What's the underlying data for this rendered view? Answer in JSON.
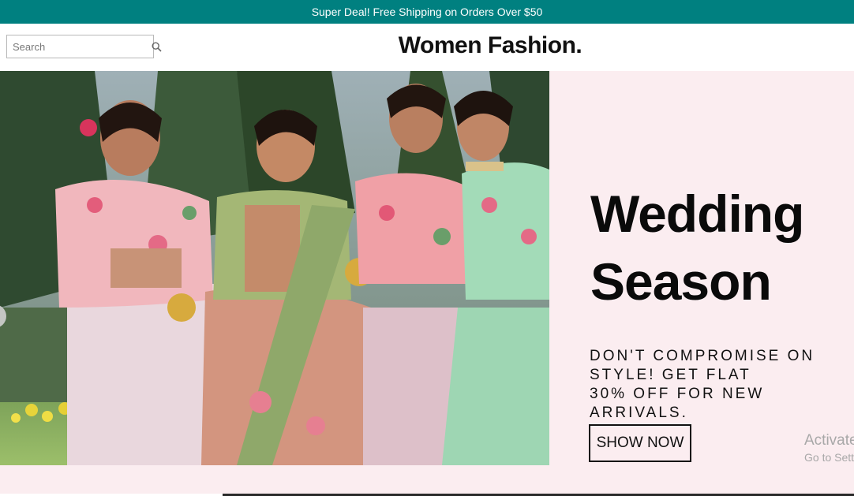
{
  "announcement": {
    "text": "Super Deal! Free Shipping on Orders Over $50"
  },
  "header": {
    "search_placeholder": "Search",
    "logo": "Women Fashion."
  },
  "hero": {
    "title": "Wedding\nSeason",
    "subtitle": "DON'T COMPROMISE ON STYLE! GET FLAT\n30% OFF FOR NEW ARRIVALS.",
    "button_label": "SHOW NOW",
    "image_icon": "wedding-women-photo"
  },
  "overlay": {
    "activate_line1": "Activate Windows",
    "activate_line2": "Go to Settings to activate Windows."
  },
  "colors": {
    "announce_bg": "#008080",
    "hero_bg": "#fbedf0",
    "text": "#111111"
  }
}
